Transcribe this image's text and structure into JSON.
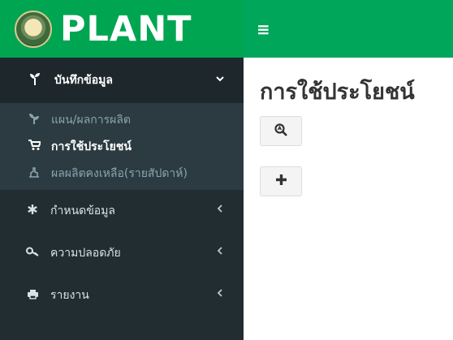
{
  "brand": {
    "text": "PLANT"
  },
  "topbar": {
    "toggle_icon": "≡"
  },
  "sidebar": {
    "open_section": {
      "label": "บันทึกข้อมูล",
      "icon": "seedling-icon",
      "chevron": "⌄",
      "items": [
        {
          "label": "แผน/ผลการผลิต",
          "icon": "sprout-icon",
          "active": false
        },
        {
          "label": "การใช้ประโยชน์",
          "icon": "cart-icon",
          "active": true
        },
        {
          "label": "ผลผลิตคงเหลือ(รายสัปดาห์)",
          "icon": "hand-icon",
          "active": false
        }
      ]
    },
    "sections": [
      {
        "label": "กำหนดข้อมูล",
        "icon": "asterisk-icon",
        "chevron": "‹"
      },
      {
        "label": "ความปลอดภัย",
        "icon": "key-icon",
        "chevron": "‹"
      },
      {
        "label": "รายงาน",
        "icon": "print-icon",
        "chevron": "‹"
      }
    ]
  },
  "main": {
    "title": "การใช้ประโยชน์",
    "search_button": {
      "icon": "search-icon"
    },
    "add_button": {
      "icon": "plus-icon"
    }
  },
  "colors": {
    "brand_green": "#00a551",
    "sidebar_bg": "#222d32",
    "submenu_bg": "#2c3b41"
  }
}
